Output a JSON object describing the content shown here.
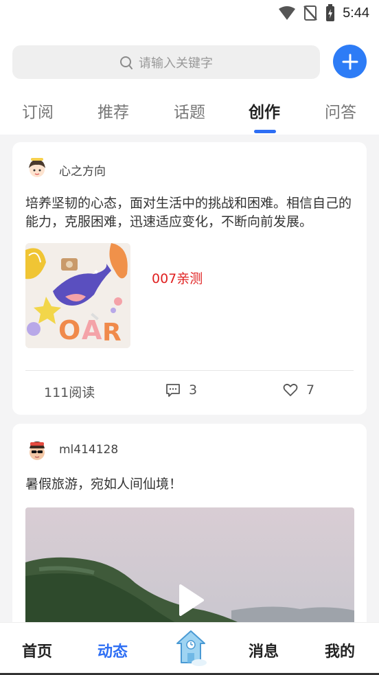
{
  "status": {
    "time": "5:44"
  },
  "search": {
    "placeholder": "请输入关键字"
  },
  "tabs": [
    {
      "label": "订阅"
    },
    {
      "label": "推荐"
    },
    {
      "label": "话题"
    },
    {
      "label": "创作",
      "active": true
    },
    {
      "label": "问答"
    }
  ],
  "posts": [
    {
      "author": "心之方向",
      "text": "培养坚韧的心态，面对生活中的挑战和困难。相信自己的能力，克服困难，迅速适应变化，不断向前发展。",
      "note": "007亲测",
      "reads": "111阅读",
      "comments": "3",
      "likes": "7"
    },
    {
      "author": "ml414128",
      "text": "暑假旅游，宛如人间仙境！"
    }
  ],
  "nav": [
    {
      "label": "首页"
    },
    {
      "label": "动态",
      "active": true
    },
    {
      "label": "消息"
    },
    {
      "label": "我的"
    }
  ],
  "colors": {
    "accent": "#2d6ef4",
    "note_red": "#e02020"
  }
}
